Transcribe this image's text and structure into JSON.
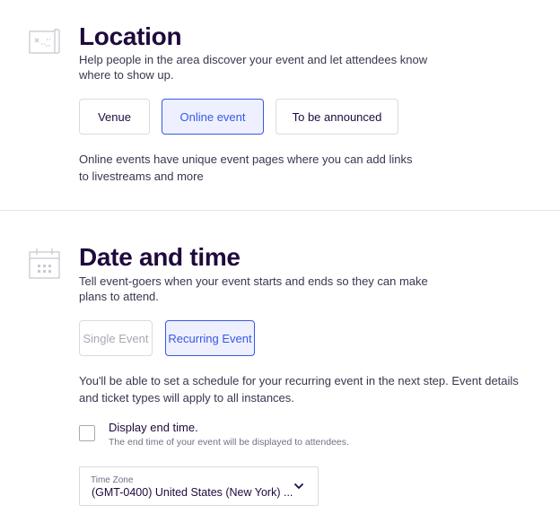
{
  "location": {
    "title": "Location",
    "description": "Help people in the area discover your event and let attendees know where to show up.",
    "icon": "map-icon",
    "options": [
      {
        "label": "Venue",
        "selected": false
      },
      {
        "label": "Online event",
        "selected": true
      },
      {
        "label": "To be announced",
        "selected": false
      }
    ],
    "info": "Online events have unique event pages where you can add links to livestreams and more"
  },
  "date_time": {
    "title": "Date and time",
    "description": "Tell event-goers when your event starts and ends so they can make plans to attend.",
    "icon": "calendar-icon",
    "options": [
      {
        "label": "Single Event",
        "selected": false
      },
      {
        "label": "Recurring Event",
        "selected": true
      }
    ],
    "info": "You'll be able to set a schedule for your recurring event in the next step. Event details and ticket types will apply to all instances.",
    "end_time": {
      "label": "Display end time.",
      "help": "The end time of your event will be displayed to attendees.",
      "checked": false
    },
    "timezone": {
      "label": "Time Zone",
      "value": "(GMT-0400) United States (New York) ..."
    }
  },
  "colors": {
    "accent": "#3659e3",
    "accent_bg": "#eef0ff",
    "heading": "#1e0a3c",
    "border": "#dbdae3"
  }
}
